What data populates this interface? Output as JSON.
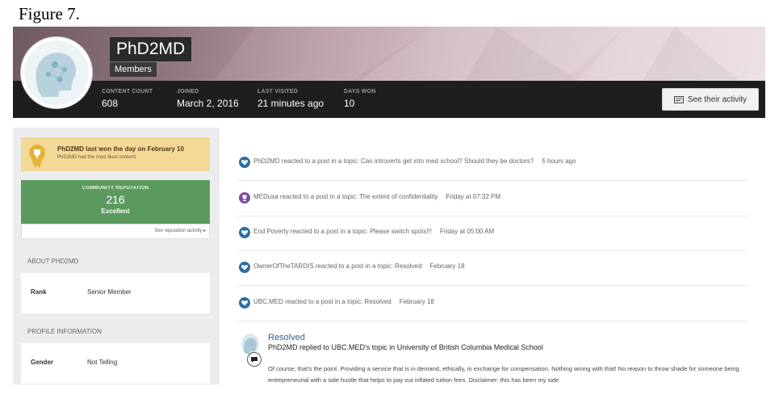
{
  "figure_label": "Figure 7.",
  "profile": {
    "username": "PhD2MD",
    "group": "Members",
    "stats": [
      {
        "label": "CONTENT COUNT",
        "value": "608"
      },
      {
        "label": "JOINED",
        "value": "March 2, 2016"
      },
      {
        "label": "LAST VISITED",
        "value": "21 minutes ago"
      },
      {
        "label": "DAYS WON",
        "value": "10"
      }
    ],
    "activity_button": "See their activity",
    "activity_icon": "activity-icon"
  },
  "sidebar": {
    "trophy": {
      "title": "PhD2MD last won the day on February 10",
      "subtitle": "PhD2MD had the most liked content!",
      "icon": "trophy-icon"
    },
    "reputation": {
      "label": "COMMUNITY REPUTATION",
      "value": "216",
      "description": "Excellent",
      "link": "See reputation activity ▸"
    },
    "about": {
      "heading": "ABOUT PHD2MD",
      "field_label": "Rank",
      "field_value": "Senior Member"
    },
    "profile_info": {
      "heading": "PROFILE INFORMATION",
      "field_label": "Gender",
      "field_value": "Not Telling"
    }
  },
  "feed": {
    "items": [
      {
        "text": "PhD2MD reacted to a post in a topic: Can introverts get into med school? Should they be doctors?",
        "time": "5 hours ago",
        "icon": "heart-reaction-icon",
        "color": "#2d6ea3"
      },
      {
        "text": "MEDusa reacted to a post in a topic: The extent of confidentiality",
        "time": "Friday at 07:32 PM",
        "icon": "trophy-reaction-icon",
        "color": "#7b4ea0"
      },
      {
        "text": "End Poverty reacted to a post in a topic: Please switch spots!!!",
        "time": "Friday at 05:00 AM",
        "icon": "heart-reaction-icon",
        "color": "#2d6ea3"
      },
      {
        "text": "OwnerOfTheTARDIS reacted to a post in a topic: Resolved",
        "time": "February 18",
        "icon": "heart-reaction-icon",
        "color": "#2d6ea3"
      },
      {
        "text": "UBC.MED reacted to a post in a topic: Resolved",
        "time": "February 18",
        "icon": "heart-reaction-icon",
        "color": "#2d6ea3"
      }
    ],
    "post": {
      "title": "Resolved",
      "meta": "PhD2MD replied to UBC.MED's topic in University of British Columbia Medical School",
      "snippet": "Of course, that's the point. Providing a service that is in demand, ethically, in exchange for compensation. Nothing wrong with that! No reason to throw shade for someone being entrepreneurial with a side hustle that helps to pay out inflated tuition fees. Disclaimer: this has been my side"
    }
  }
}
